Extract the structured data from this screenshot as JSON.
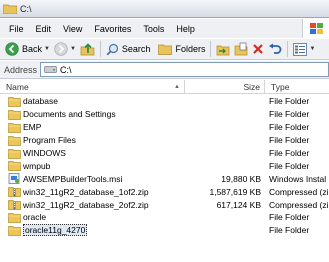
{
  "window": {
    "title": "C:\\"
  },
  "menu": [
    "File",
    "Edit",
    "View",
    "Favorites",
    "Tools",
    "Help"
  ],
  "toolbar": {
    "back_label": "Back",
    "search_label": "Search",
    "folders_label": "Folders"
  },
  "address": {
    "label": "Address",
    "value": "C:\\"
  },
  "columns": {
    "name": "Name",
    "size": "Size",
    "type": "Type"
  },
  "files": [
    {
      "name": "database",
      "size": "",
      "type": "File Folder",
      "icon": "folder-icon"
    },
    {
      "name": "Documents and Settings",
      "size": "",
      "type": "File Folder",
      "icon": "folder-icon"
    },
    {
      "name": "EMP",
      "size": "",
      "type": "File Folder",
      "icon": "folder-icon"
    },
    {
      "name": "Program Files",
      "size": "",
      "type": "File Folder",
      "icon": "folder-icon"
    },
    {
      "name": "WINDOWS",
      "size": "",
      "type": "File Folder",
      "icon": "folder-icon"
    },
    {
      "name": "wmpub",
      "size": "",
      "type": "File Folder",
      "icon": "folder-icon"
    },
    {
      "name": "AWSEMPBuilderTools.msi",
      "size": "19,880 KB",
      "type": "Windows Instal",
      "icon": "msi-icon"
    },
    {
      "name": "win32_11gR2_database_1of2.zip",
      "size": "1,587,619 KB",
      "type": "Compressed (zi",
      "icon": "zip-icon"
    },
    {
      "name": "win32_11gR2_database_2of2.zip",
      "size": "617,124 KB",
      "type": "Compressed (zi",
      "icon": "zip-icon"
    },
    {
      "name": "oracle",
      "size": "",
      "type": "File Folder",
      "icon": "folder-icon"
    },
    {
      "name": "oracle11g_4270",
      "size": "",
      "type": "File Folder",
      "icon": "folder-icon",
      "selected": true
    }
  ]
}
